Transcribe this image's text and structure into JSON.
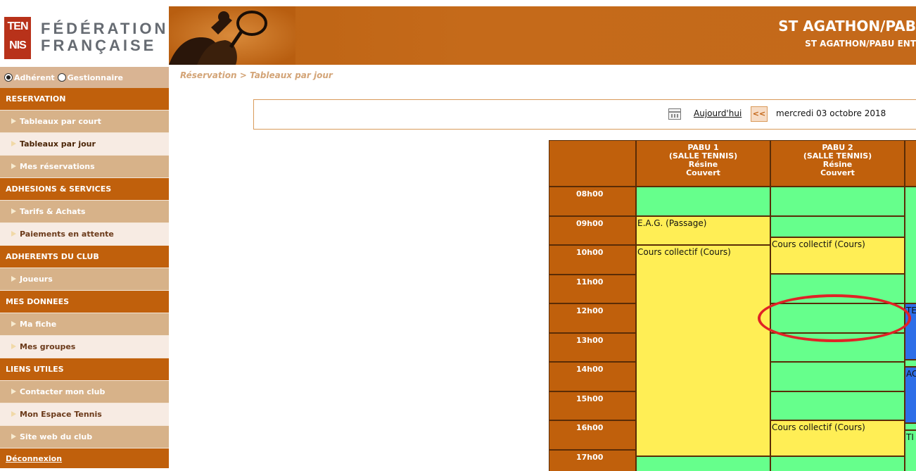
{
  "header": {
    "logo_top": "TEN",
    "logo_bottom": "NIS",
    "federation_line1": "FÉDÉRATION",
    "federation_line2": "FRANÇAISE",
    "club_title": "ST AGATHON/PAB",
    "club_subtitle": "ST AGATHON/PABU ENT"
  },
  "sidebar": {
    "roles": [
      {
        "label": "Adhérent",
        "checked": true
      },
      {
        "label": "Gestionnaire",
        "checked": false
      }
    ],
    "sections": [
      {
        "title": "RESERVATION",
        "items": [
          {
            "label": "Tableaux par court",
            "style": "tan",
            "arrow": true
          },
          {
            "label": "Tableaux par jour",
            "style": "light",
            "arrow": true,
            "active": true
          },
          {
            "label": "Mes réservations",
            "style": "tan",
            "arrow": true
          }
        ]
      },
      {
        "title": "ADHESIONS & SERVICES",
        "items": [
          {
            "label": "Tarifs & Achats",
            "style": "tan",
            "arrow": true
          },
          {
            "label": "Paiements en attente",
            "style": "light",
            "arrow": true
          }
        ]
      },
      {
        "title": "ADHERENTS DU CLUB",
        "items": [
          {
            "label": "Joueurs",
            "style": "tan",
            "arrow": true
          }
        ]
      },
      {
        "title": "MES DONNEES",
        "items": [
          {
            "label": "Ma fiche",
            "style": "tan",
            "arrow": true
          },
          {
            "label": "Mes groupes",
            "style": "light",
            "arrow": true
          }
        ]
      },
      {
        "title": "LIENS UTILES",
        "items": [
          {
            "label": "Contacter mon club",
            "style": "tan",
            "arrow": true
          },
          {
            "label": "Mon Espace Tennis",
            "style": "light",
            "arrow": true
          },
          {
            "label": "Site web du club",
            "style": "tan",
            "arrow": true
          }
        ]
      }
    ],
    "logout": "Déconnexion"
  },
  "breadcrumb": "Réservation > Tableaux par jour",
  "datebar": {
    "today_label": "Aujourd'hui",
    "prev_label": "<<",
    "current_date": "mercredi 03 octobre 2018"
  },
  "courts": [
    {
      "name": "PABU 1",
      "hall": "(SALLE TENNIS)",
      "surface": "Résine",
      "type": "Couvert"
    },
    {
      "name": "PABU 2",
      "hall": "(SALLE TENNIS)",
      "surface": "Résine",
      "type": "Couvert"
    }
  ],
  "times": [
    "08h00",
    "09h00",
    "10h00",
    "11h00",
    "12h00",
    "13h00",
    "14h00",
    "15h00",
    "16h00",
    "17h00"
  ],
  "bookings": {
    "court1": [
      {
        "label": "",
        "color": "green"
      },
      {
        "label": "E.A.G. (Passage)",
        "color": "yellow"
      },
      {
        "label": "Cours collectif (Cours)",
        "color": "yellow"
      },
      {
        "label": "",
        "color": "green"
      }
    ],
    "court2": [
      {
        "label": "",
        "color": "green"
      },
      {
        "label": "",
        "color": "green"
      },
      {
        "label": "Cours collectif (Cours)",
        "color": "yellow"
      },
      {
        "label": "",
        "color": "green"
      },
      {
        "label": "",
        "color": "green"
      },
      {
        "label": "",
        "color": "green"
      },
      {
        "label": "",
        "color": "green"
      },
      {
        "label": "",
        "color": "green"
      },
      {
        "label": "Cours collectif (Cours)",
        "color": "yellow"
      },
      {
        "label": "",
        "color": "green"
      }
    ],
    "court3_partial": [
      {
        "label": "",
        "color": "green"
      },
      {
        "label": "TE",
        "color": "blue"
      },
      {
        "label": "",
        "color": "green"
      },
      {
        "label": "AC",
        "color": "blue"
      },
      {
        "label": "",
        "color": "green"
      },
      {
        "label": "TI",
        "color": "green"
      }
    ]
  },
  "colors": {
    "brand_orange": "#c0600c",
    "free_slot": "#66ff8c",
    "booked_slot": "#ffee55",
    "other_slot": "#2d6ee8",
    "annotation_circle": "#e02226"
  }
}
